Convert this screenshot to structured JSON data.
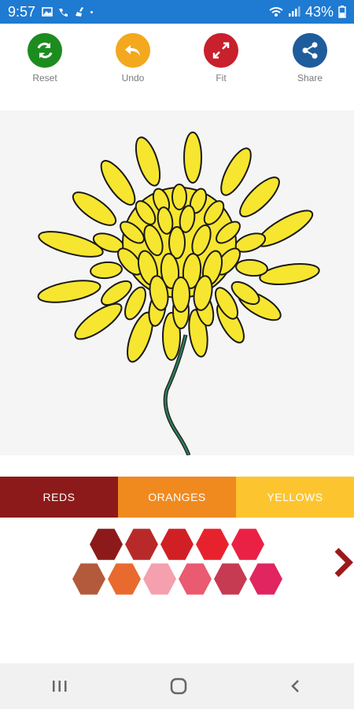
{
  "status_bar": {
    "time": "9:57",
    "battery": "43%",
    "icons": [
      "image-icon",
      "wifi-calling-icon",
      "broom-icon",
      "notification-dot",
      "wifi-icon",
      "signal-icon",
      "battery-icon"
    ]
  },
  "toolbar": {
    "reset": {
      "label": "Reset",
      "color": "#1d8c1f",
      "icon": "refresh-icon"
    },
    "undo": {
      "label": "Undo",
      "color": "#f3a81e",
      "icon": "undo-icon"
    },
    "fit": {
      "label": "Fit",
      "color": "#c8202c",
      "icon": "expand-icon"
    },
    "share": {
      "label": "Share",
      "color": "#1f5c9c",
      "icon": "share-icon"
    }
  },
  "canvas": {
    "background": "#f5f5f5",
    "petal_color": "#f7e62f",
    "stem_color": "#2e7d5a"
  },
  "palette_tabs": [
    {
      "label": "REDS",
      "color": "#8c1a1a",
      "selected": true
    },
    {
      "label": "ORANGES",
      "color": "#f08a1f",
      "selected": false
    },
    {
      "label": "YELLOWS",
      "color": "#fcc530",
      "selected": false
    }
  ],
  "swatches": {
    "row1": [
      "#8c1a1a",
      "#b82a2a",
      "#d11f26",
      "#e8222d",
      "#ea2145"
    ],
    "row2": [
      "#b35a3c",
      "#e86a2e",
      "#f4a0ae",
      "#ea5a70",
      "#c63a52",
      "#e02560"
    ]
  },
  "next_arrow_color": "#9a1a1a",
  "nav_bar": {
    "icons": [
      "recent-apps-icon",
      "home-icon",
      "back-icon"
    ]
  }
}
